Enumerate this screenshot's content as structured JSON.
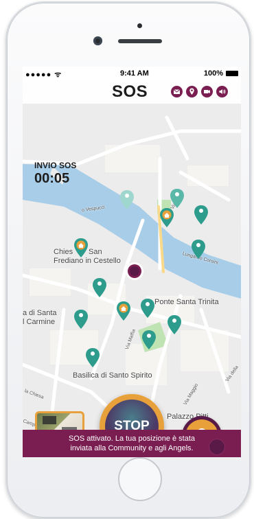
{
  "status_bar": {
    "carrier": "●●●●● ᯤ",
    "time": "9:41 AM",
    "battery": "100%"
  },
  "header": {
    "title": "SOS",
    "icons": [
      "envelope-icon",
      "location-pin-icon",
      "video-icon",
      "speaker-icon"
    ]
  },
  "timer": {
    "label": "INVIO SOS",
    "value": "00:05"
  },
  "map": {
    "labels": {
      "via_vespucci": "o Vespucci",
      "via_orti": "Via Orti",
      "chiesa": "Chiesa di San Frediano in Cestello",
      "chiesa_line1": "Chies",
      "chiesa_line2": "San",
      "chiesa_line3": "Frediano in Cestello",
      "lungarno": "Lungarno Corsini",
      "ponte": "Ponte Santa Trinita",
      "santa_line1": "a di Santa",
      "santa_line2": "l Carmine",
      "via_maffia": "Via Maffia",
      "via_maggio": "Via Maggio",
      "basilica": "Basilica di Santo Spirito",
      "via_della": "Via della",
      "chiesa_road": "la Chiesa",
      "palazzo": "Palazzo Pitti",
      "camp": "Camp"
    }
  },
  "stop_button": {
    "label": "STOP"
  },
  "footer": {
    "message_line1": "SOS attivato. La tua posizione è stata",
    "message_line2": "inviata alla Community e agli Angels."
  },
  "colors": {
    "brand": "#7a1e52",
    "accent": "#e8a13a",
    "pin": "#2e9c8c",
    "water": "#a8cde8"
  }
}
